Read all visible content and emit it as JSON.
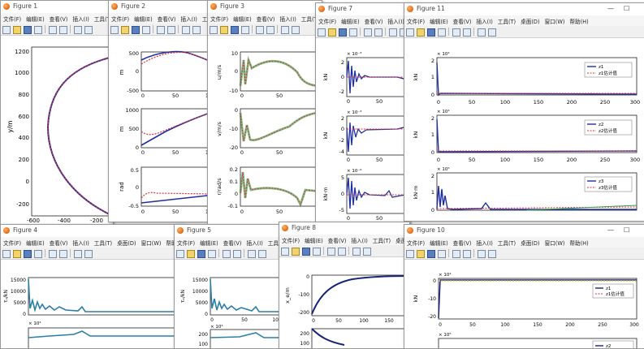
{
  "menu": [
    "文件(F)",
    "编辑(E)",
    "查看(V)",
    "插入(I)",
    "工具(T)",
    "桌面(D)",
    "窗口(W)",
    "帮助(H)"
  ],
  "toolbar_icons": [
    "new-file-icon",
    "open-folder-icon",
    "save-icon",
    "print-icon",
    "zoom-icon",
    "dock-icon",
    "grid-icon",
    "arrow-icon"
  ],
  "windows": {
    "fig1": {
      "title": "Figure 1"
    },
    "fig2": {
      "title": "Figure 2"
    },
    "fig3": {
      "title": "Figure 3"
    },
    "fig7": {
      "title": "Figure 7"
    },
    "fig11": {
      "title": "Figure 11"
    },
    "fig4": {
      "title": "Figure 4"
    },
    "fig5": {
      "title": "Figure 5"
    },
    "fig8": {
      "title": "Figure 8"
    },
    "fig10": {
      "title": "Figure 10"
    }
  },
  "chart_data": [
    {
      "figure": "Figure 1",
      "type": "line",
      "ylabel": "y/m",
      "yticks": [
        "1200",
        "1000",
        "800",
        "600",
        "400",
        "200",
        "0",
        "-200"
      ],
      "xticks": [
        "-600",
        "-400",
        "-200"
      ],
      "series": [
        {
          "color": "#1f2fa0"
        },
        {
          "color": "#e0303a"
        }
      ]
    },
    {
      "figure": "Figure 2",
      "type": "line",
      "subplots": [
        {
          "ylabel": "m",
          "yticks": [
            "500",
            "0",
            "-500"
          ],
          "xticks": [
            "0",
            "50",
            "10"
          ]
        },
        {
          "ylabel": "m",
          "yticks": [
            "1000",
            "500",
            "0"
          ],
          "xticks": [
            "0",
            "50",
            "10"
          ]
        },
        {
          "ylabel": "rad",
          "yticks": [
            "0.5",
            "0",
            "-0.5"
          ],
          "xticks": [
            "0",
            "50",
            "10"
          ]
        }
      ]
    },
    {
      "figure": "Figure 3",
      "type": "line",
      "subplots": [
        {
          "ylabel": "u/m/s",
          "yticks": [
            "10",
            "0",
            "-10"
          ],
          "xticks": [
            "0",
            "50",
            "1"
          ]
        },
        {
          "ylabel": "v/m/s",
          "yticks": [
            "0",
            "-10",
            "-20"
          ],
          "xticks": [
            "0",
            "50",
            "1"
          ]
        },
        {
          "ylabel": "r/rad/s",
          "yticks": [
            "0.2",
            "0.1",
            "0",
            "-0.1"
          ],
          "xticks": [
            "0",
            "50",
            "1"
          ]
        }
      ]
    },
    {
      "figure": "Figure 7",
      "type": "line",
      "subplots": [
        {
          "ylabel": "kN",
          "exponent": "× 10⁻³",
          "yticks": [
            "2",
            "0",
            "-2"
          ],
          "xticks": [
            "0",
            "50",
            "1"
          ]
        },
        {
          "ylabel": "kN",
          "exponent": "× 10⁻³",
          "yticks": [
            "2",
            "0",
            "-2",
            "-4"
          ],
          "xticks": [
            "0",
            "50",
            "1"
          ]
        },
        {
          "ylabel": "kN·m",
          "exponent": "× 10⁻⁶",
          "yticks": [
            "5",
            "0",
            "-5"
          ],
          "xticks": [
            "0",
            "50",
            "1"
          ]
        }
      ]
    },
    {
      "figure": "Figure 11",
      "type": "line",
      "subplots": [
        {
          "ylabel": "kN",
          "exponent": "× 10⁴",
          "yticks": [
            "2",
            "1",
            "0"
          ],
          "xticks": [
            "0",
            "50",
            "100",
            "150",
            "200",
            "250",
            "300"
          ],
          "legend": [
            "z1",
            "z1估计值"
          ]
        },
        {
          "ylabel": "kN",
          "exponent": "× 10⁴",
          "yticks": [
            "2",
            "1",
            "0"
          ],
          "xticks": [
            "0",
            "50",
            "100",
            "150",
            "200",
            "250",
            "300"
          ],
          "legend": [
            "z2",
            "z2估计值"
          ]
        },
        {
          "ylabel": "kN·m",
          "exponent": "× 10⁵",
          "yticks": [
            "2",
            "1",
            "0"
          ],
          "xticks": [
            "0",
            "50",
            "100",
            "150",
            "200",
            "250",
            "300"
          ],
          "legend": [
            "z3",
            "z3估计值"
          ]
        }
      ]
    },
    {
      "figure": "Figure 4",
      "type": "line",
      "subplots": [
        {
          "ylabel": "τᵤ/kN",
          "yticks": [
            "15000",
            "10000",
            "5000",
            "0"
          ],
          "exponent2": "× 10⁴"
        }
      ]
    },
    {
      "figure": "Figure 5",
      "type": "line",
      "subplots": [
        {
          "ylabel": "τᵥ/kN",
          "yticks": [
            "15000",
            "10000",
            "5000",
            "0"
          ],
          "xticks": [
            "0",
            "50",
            "100"
          ],
          "exponent2": "× 10⁴",
          "yticks2": [
            "200",
            "100"
          ]
        }
      ]
    },
    {
      "figure": "Figure 8",
      "type": "line",
      "subplots": [
        {
          "ylabel": "x_e/m",
          "yticks": [
            "0",
            "-100",
            "-200"
          ],
          "xticks": [
            "0",
            "50",
            "100",
            "150"
          ],
          "yticks2": [
            "200",
            "100"
          ]
        }
      ]
    },
    {
      "figure": "Figure 10",
      "type": "line",
      "subplots": [
        {
          "ylabel": "kN",
          "exponent": "× 10⁴",
          "yticks": [
            "0",
            "-10",
            "-20"
          ],
          "xticks": [
            "0",
            "50",
            "100",
            "150",
            "200",
            "250",
            "300"
          ],
          "legend": [
            "z1",
            "z1估计值"
          ],
          "legend2": [
            "z2"
          ],
          "exponent2": "× 10⁵"
        }
      ]
    }
  ]
}
